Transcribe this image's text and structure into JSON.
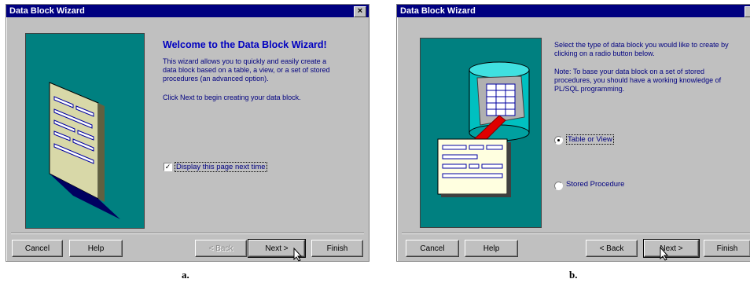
{
  "dialog_a": {
    "title": "Data Block Wizard",
    "close_glyph": "×",
    "heading": "Welcome to the Data Block Wizard!",
    "para1_line1": "This wizard allows you to quickly and easily create a",
    "para1_line2": "data block based on a table, a view, or a set of stored",
    "para1_line3": "procedures (an advanced option).",
    "para2": "Click Next to begin creating your data block.",
    "checkbox_label": "Display this page next time",
    "checkbox_checked": true,
    "buttons": {
      "cancel": "Cancel",
      "help": "Help",
      "back": "< Back",
      "next": "Next >",
      "finish": "Finish"
    }
  },
  "dialog_b": {
    "title": "Data Block Wizard",
    "instr_line1": "Select the type of data block you would like to create by",
    "instr_line2": "clicking on a radio button below.",
    "note_line1": "Note: To base your data block on a set of stored",
    "note_line2": "procedures, you should have a working knowledge of",
    "note_line3": "PL/SQL programming.",
    "radio_table": "Table or View",
    "radio_table_selected": true,
    "radio_proc": "Stored Procedure",
    "radio_proc_selected": false,
    "buttons": {
      "cancel": "Cancel",
      "help": "Help",
      "back": "< Back",
      "next": "Next >",
      "finish": "Finish"
    }
  },
  "captions": {
    "a": "a.",
    "b": "b."
  },
  "icons": {
    "cursor": "arrow-cursor-icon",
    "database": "database-icon",
    "form": "form-icon",
    "arrow": "red-arrow-icon"
  }
}
